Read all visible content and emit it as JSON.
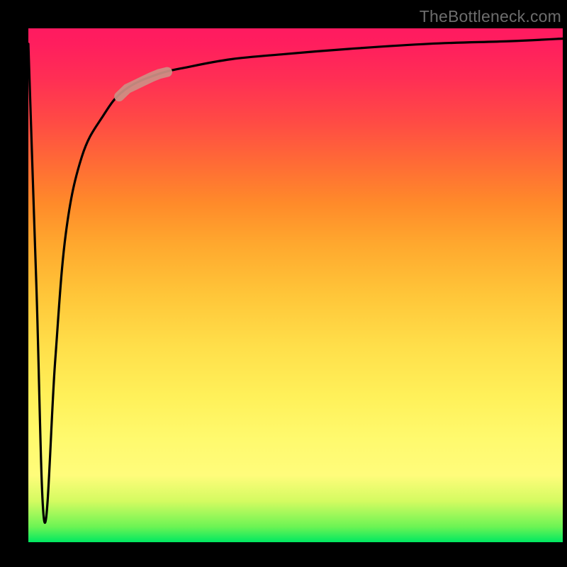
{
  "watermark": "TheBottleneck.com",
  "colors": {
    "background": "#000000",
    "curve": "#000000",
    "highlight": "#cd8f84",
    "watermark_text": "#6d6d6d"
  },
  "chart_data": {
    "type": "line",
    "title": "",
    "xlabel": "",
    "ylabel": "",
    "xlim": [
      0,
      100
    ],
    "ylim": [
      0,
      100
    ],
    "grid": false,
    "legend": false,
    "note": "Values read off pixel positions; origin bottom-left; y increases upward. Bottleneck-style curve: dips to ~0 near x≈3 then rises steeply and asymptotes ~98.",
    "series": [
      {
        "name": "bottleneck-curve",
        "x": [
          0,
          1.5,
          3,
          5,
          7,
          10,
          14,
          18,
          24,
          30,
          38,
          48,
          60,
          75,
          90,
          100
        ],
        "values": [
          97,
          50,
          4,
          35,
          60,
          75,
          83,
          88,
          91,
          92.5,
          94,
          95,
          96,
          97,
          97.5,
          98
        ]
      }
    ],
    "highlight_segment": {
      "x_start": 17,
      "x_end": 26,
      "description": "pinkish-brown thick pill over curve near upper-left bend"
    },
    "gradient_bg": {
      "orientation": "vertical",
      "stops": [
        {
          "pos": 0.0,
          "color": "#00e861"
        },
        {
          "pos": 0.1,
          "color": "#d4fb61"
        },
        {
          "pos": 0.2,
          "color": "#fffa6e"
        },
        {
          "pos": 0.4,
          "color": "#ffdf4a"
        },
        {
          "pos": 0.6,
          "color": "#ffa82e"
        },
        {
          "pos": 0.8,
          "color": "#ff4a45"
        },
        {
          "pos": 1.0,
          "color": "#ff1a60"
        }
      ]
    }
  }
}
